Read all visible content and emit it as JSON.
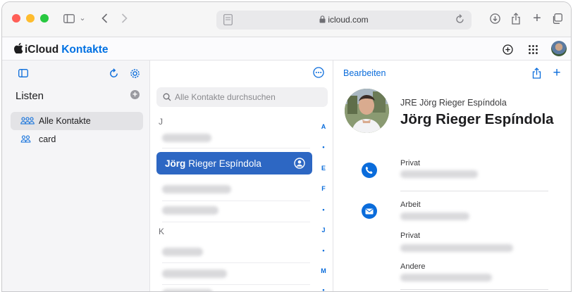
{
  "browser": {
    "url": "icloud.com"
  },
  "app": {
    "brand_prefix": "iCloud",
    "brand_name": "Kontakte",
    "accent_color": "#0a6cdb",
    "selected_color": "#2d67c3"
  },
  "sidebar": {
    "title": "Listen",
    "items": [
      {
        "label": "Alle Kontakte",
        "icon": "people-group-icon",
        "active": true
      },
      {
        "label": "card",
        "icon": "people-pair-icon",
        "active": false
      }
    ]
  },
  "contacts": {
    "search_placeholder": "Alle Kontakte durchsuchen",
    "sections": [
      "J",
      "K"
    ],
    "selected": {
      "first": "Jörg",
      "rest": "Rieger Espíndola"
    },
    "index_letters": [
      "A",
      "•",
      "E",
      "F",
      "•",
      "J",
      "•",
      "M",
      "•"
    ]
  },
  "detail": {
    "edit_label": "Bearbeiten",
    "initials_line": "JRE Jörg Rieger Espíndola",
    "full_name": "Jörg Rieger Espíndola",
    "fields": [
      {
        "label": "Privat",
        "kind": "phone"
      },
      {
        "label": "Arbeit",
        "kind": "email"
      },
      {
        "label": "Privat",
        "kind": "email"
      },
      {
        "label": "Andere",
        "kind": "email"
      }
    ]
  }
}
